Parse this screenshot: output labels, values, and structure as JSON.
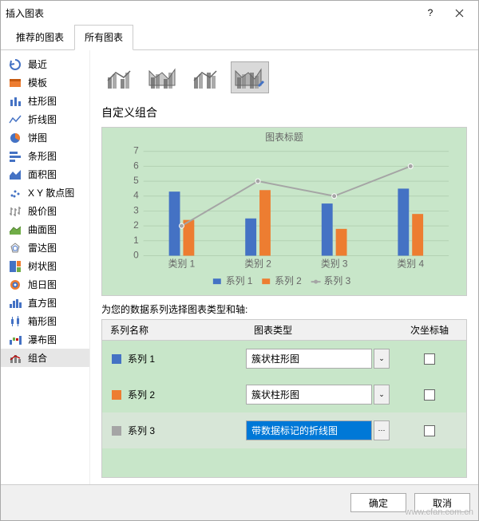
{
  "dialog": {
    "title": "插入图表"
  },
  "tabs": [
    "推荐的图表",
    "所有图表"
  ],
  "sidebar": {
    "items": [
      {
        "label": "最近",
        "icon": "recent"
      },
      {
        "label": "模板",
        "icon": "template"
      },
      {
        "label": "柱形图",
        "icon": "column"
      },
      {
        "label": "折线图",
        "icon": "line"
      },
      {
        "label": "饼图",
        "icon": "pie"
      },
      {
        "label": "条形图",
        "icon": "bar"
      },
      {
        "label": "面积图",
        "icon": "area"
      },
      {
        "label": "X Y 散点图",
        "icon": "scatter"
      },
      {
        "label": "股价图",
        "icon": "stock"
      },
      {
        "label": "曲面图",
        "icon": "surface"
      },
      {
        "label": "雷达图",
        "icon": "radar"
      },
      {
        "label": "树状图",
        "icon": "treemap"
      },
      {
        "label": "旭日图",
        "icon": "sunburst"
      },
      {
        "label": "直方图",
        "icon": "histogram"
      },
      {
        "label": "箱形图",
        "icon": "boxplot"
      },
      {
        "label": "瀑布图",
        "icon": "waterfall"
      },
      {
        "label": "组合",
        "icon": "combo"
      }
    ]
  },
  "section_title": "自定义组合",
  "grid_instruction": "为您的数据系列选择图表类型和轴:",
  "grid_head": {
    "name": "系列名称",
    "type": "图表类型",
    "axis": "次坐标轴"
  },
  "series": [
    {
      "label": "系列 1",
      "type": "簇状柱形图",
      "color": "#4472C4",
      "secondary": false
    },
    {
      "label": "系列 2",
      "type": "簇状柱形图",
      "color": "#ED7D31",
      "secondary": false
    },
    {
      "label": "系列 3",
      "type": "带数据标记的折线图",
      "color": "#A5A5A5",
      "secondary": false
    }
  ],
  "footer": {
    "ok": "确定",
    "cancel": "取消"
  },
  "watermark": "www.cfan.com.cn",
  "chart_data": {
    "type": "combo",
    "title": "图表标题",
    "xlabel": "",
    "ylabel": "",
    "ylim": [
      0,
      7
    ],
    "categories": [
      "类别 1",
      "类别 2",
      "类别 3",
      "类别 4"
    ],
    "series": [
      {
        "name": "系列 1",
        "type": "bar",
        "color": "#4472C4",
        "values": [
          4.3,
          2.5,
          3.5,
          4.5
        ]
      },
      {
        "name": "系列 2",
        "type": "bar",
        "color": "#ED7D31",
        "values": [
          2.4,
          4.4,
          1.8,
          2.8
        ]
      },
      {
        "name": "系列 3",
        "type": "line",
        "color": "#A5A5A5",
        "values": [
          2.0,
          5.0,
          4.0,
          6.0
        ]
      }
    ]
  }
}
